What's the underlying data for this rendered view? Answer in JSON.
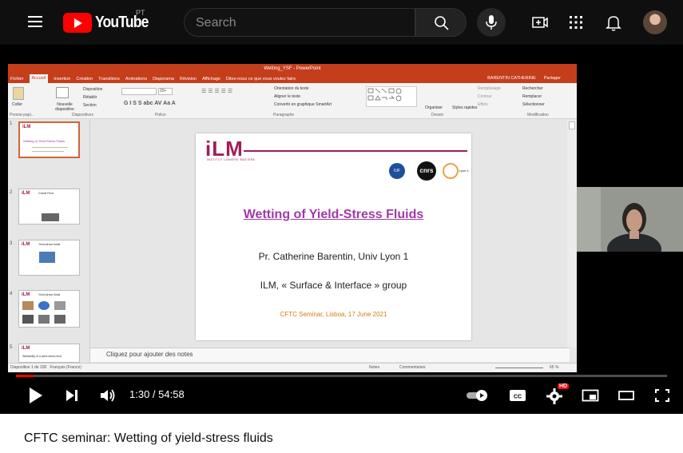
{
  "youtube": {
    "logo_text": "YouTube",
    "country_code": "PT",
    "search_placeholder": "Search"
  },
  "powerpoint": {
    "window_title": "Wetting_YSF - PowerPoint",
    "user_name": "BARENTIN CATHERINE",
    "share_label": "Partager",
    "tabs": [
      "Fichier",
      "Accueil",
      "Insertion",
      "Création",
      "Transitions",
      "Animations",
      "Diaporama",
      "Révision",
      "Affichage"
    ],
    "tell_me": "Dites-nous ce que vous voulez faire.",
    "ribbon": {
      "coller": "Coller",
      "nouvelle_diapositive": "Nouvelle diapositive",
      "disposition": "Disposition",
      "retablir": "Rétablir",
      "section": "Section",
      "font_size": "20+",
      "orientation_texte": "Orientation du texte",
      "aligner_texte": "Aligner le texte",
      "convertir_smartart": "Convertir en graphique SmartArt",
      "organiser": "Organiser",
      "styles_rapides": "Styles rapides",
      "remplissage": "Remplissage",
      "contour": "Contour",
      "effets": "Effets",
      "rechercher": "Rechercher",
      "remplacer": "Remplacer",
      "selectionner": "Sélectionner",
      "groups": [
        "Presse-papi...",
        "Diapositives",
        "Police",
        "Paragraphe",
        "Dessin",
        "Modification"
      ]
    },
    "slide": {
      "logo": "iLM",
      "logo_sub": "INSTITUT LUMIÈRE MATIÈRE",
      "lyon_label": "Lyon 1",
      "cnrs_label": "cnrs",
      "iuf_label": "IUF",
      "title": "Wetting of Yield-Stress Fluids",
      "author": "Pr. Catherine Barentin, Univ Lyon 1",
      "group": "ILM, « Surface & Interface » group",
      "footer": "CFTC Seminar, Lisboa, 17 June 2021"
    },
    "thumb_numbers": [
      "1",
      "2",
      "3",
      "4",
      "5"
    ],
    "thumb_titles": [
      "Wetting of Yield-Stress Fluids",
      "Gravel Fluid",
      "Yield-stress fluids",
      "Yield-stress fluids",
      "Wettability of a yield-stress fluid"
    ],
    "notes_placeholder": "Cliquez pour ajouter des notes",
    "status_left": "Diapositive 1 de 100",
    "status_lang": "Français (France)",
    "status_notes": "Notes",
    "status_comments": "Commentaires",
    "zoom": "65 %"
  },
  "player": {
    "progress": 0.0276,
    "current_time": "1:30",
    "separator": " / ",
    "duration": "54:58",
    "hd_badge": "HD"
  },
  "video_title": "CFTC seminar: Wetting of yield-stress fluids",
  "colors": {
    "accent": "#ff0000",
    "ppt": "#c43e1c",
    "ilm": "#a01e5a",
    "title": "#a03aa6"
  }
}
